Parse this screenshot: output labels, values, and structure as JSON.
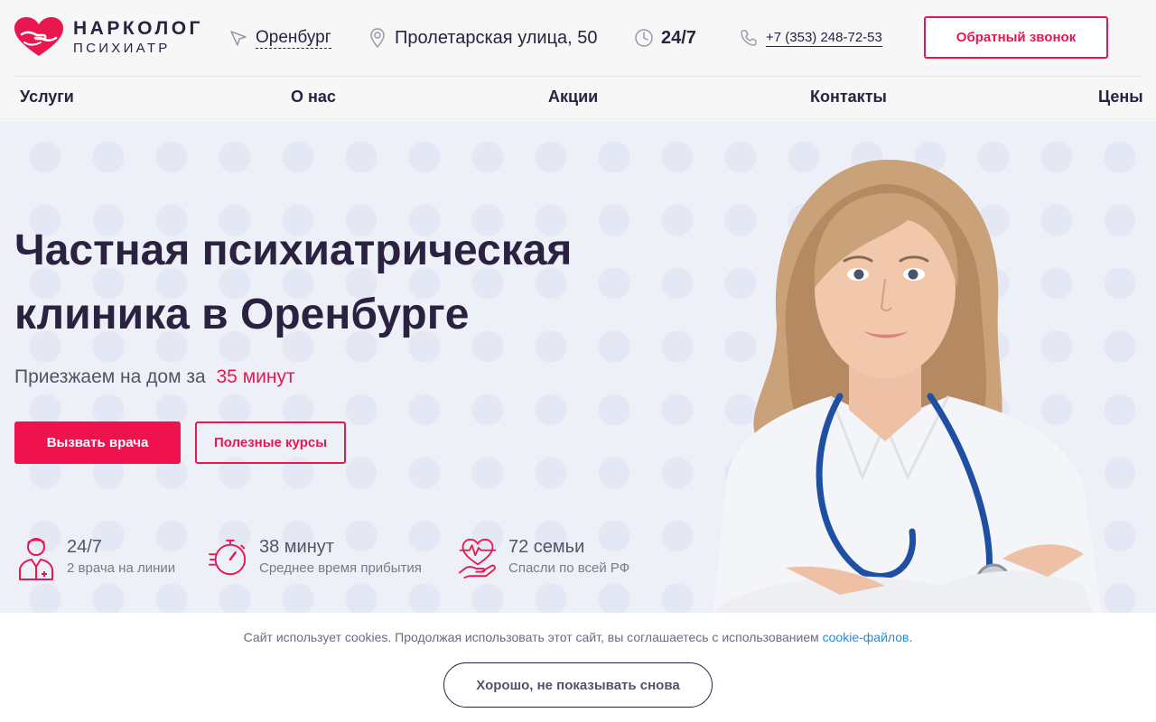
{
  "logo": {
    "line1": "НАРКОЛОГ",
    "line2": "ПСИХИАТР",
    "icon": "heart-hands-icon"
  },
  "header": {
    "city": "Оренбург",
    "address": "Пролетарская улица, 50",
    "hours": "24/7",
    "phone": "+7 (353) 248-72-53",
    "callback_label": "Обратный звонок"
  },
  "nav": [
    "Услуги",
    "О нас",
    "Акции",
    "Контакты",
    "Цены"
  ],
  "hero": {
    "title_line1": "Частная психиатрическая",
    "title_line2": "клиника в Оренбурге",
    "subtitle": "Приезжаем на дом за",
    "subtitle_accent": "35 минут",
    "btn_call": "Вызвать врача",
    "btn_courses": "Полезные курсы"
  },
  "stats": [
    {
      "value": "24/7",
      "label": "2 врача на линии",
      "icon": "doctor-icon"
    },
    {
      "value": "38 минут",
      "label": "Среднее время прибытия",
      "icon": "stopwatch-icon"
    },
    {
      "value": "72 семьи",
      "label": "Спасли по всей РФ",
      "icon": "heart-pulse-hand-icon"
    }
  ],
  "cookie": {
    "text": "Сайт использует cookies. Продолжая использовать этот сайт, вы соглашаетесь с использованием",
    "link": "cookie-файлов",
    "end": ".",
    "button": "Хорошо, не показывать снова"
  },
  "colors": {
    "accent": "#e8174f",
    "dark": "#2b2140",
    "link": "#2a8bd0",
    "hero_bg": "#eef0f8"
  }
}
